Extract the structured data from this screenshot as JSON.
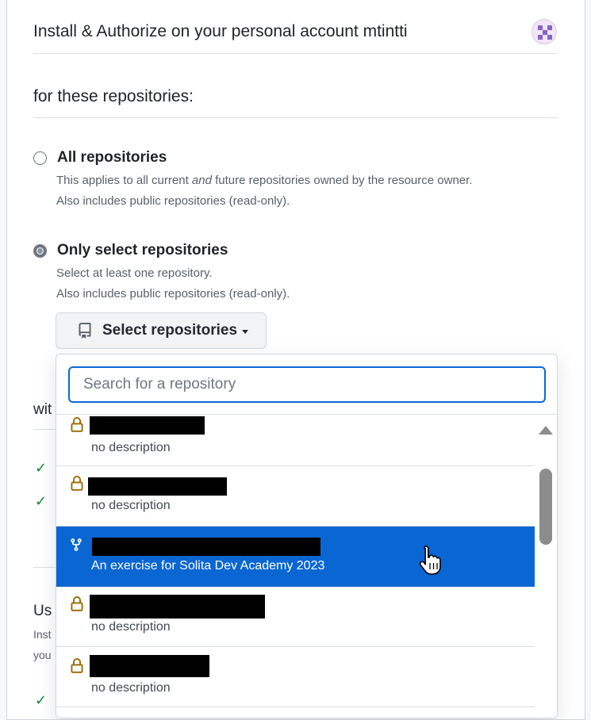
{
  "header": {
    "title": "Install & Authorize on your personal account mtintti"
  },
  "repositories_section": {
    "title": "for these repositories:"
  },
  "options": {
    "all": {
      "label": "All repositories",
      "desc_line1_before": "This applies to all current ",
      "desc_line1_em": "and",
      "desc_line1_after": " future repositories owned by the resource owner.",
      "desc_line2": "Also includes public repositories (read-only).",
      "checked": false
    },
    "select": {
      "label": "Only select repositories",
      "desc_line1": "Select at least one repository.",
      "desc_line2": "Also includes public repositories (read-only).",
      "checked": true
    }
  },
  "select_button": {
    "label": "Select repositories"
  },
  "background_fragments": {
    "with": "wit",
    "user_heading": "Us",
    "inst": "Inst",
    "you": "you"
  },
  "dropdown": {
    "search_placeholder": "Search for a repository",
    "items": [
      {
        "icon": "lock-icon",
        "description": "no description",
        "selected": false
      },
      {
        "icon": "lock-icon",
        "description": "no description",
        "selected": false
      },
      {
        "icon": "repo-forked-icon",
        "description": "An exercise for Solita Dev Academy 2023",
        "selected": true
      },
      {
        "icon": "lock-icon",
        "description": "no description",
        "selected": false
      },
      {
        "icon": "lock-icon",
        "description": "no description",
        "selected": false
      }
    ]
  },
  "colors": {
    "accent_blue": "#0969da",
    "selected_row": "#0a66d2",
    "lock_gold": "#9a6700",
    "check_green": "#1a7f37"
  }
}
